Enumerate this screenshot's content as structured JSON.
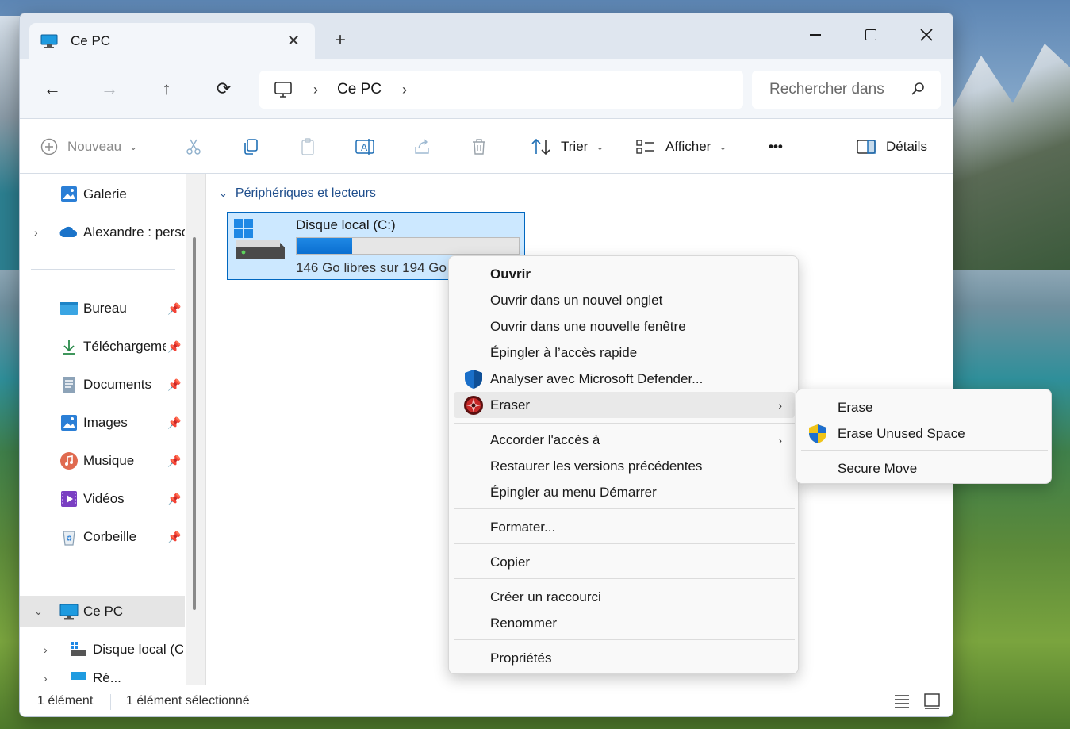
{
  "window": {
    "tab_title": "Ce PC",
    "tab_close": "✕",
    "new_tab": "+"
  },
  "nav": {
    "back": "←",
    "forward": "→",
    "up": "↑",
    "refresh": "⟳",
    "breadcrumb": [
      "Ce PC"
    ],
    "crumb_sep": "›",
    "search_placeholder": "Rechercher dans"
  },
  "toolbar": {
    "new_label": "Nouveau",
    "sort_label": "Trier",
    "view_label": "Afficher",
    "more_label": "•••",
    "details_label": "Détails"
  },
  "sidebar": {
    "items": [
      {
        "label": "Galerie",
        "icon": "gallery-icon"
      },
      {
        "label": "Alexandre : perso",
        "icon": "onedrive-cloud-icon"
      },
      {
        "label": "Bureau",
        "icon": "desktop-folder-icon"
      },
      {
        "label": "Téléchargements",
        "icon": "download-icon"
      },
      {
        "label": "Documents",
        "icon": "documents-icon"
      },
      {
        "label": "Images",
        "icon": "pictures-icon"
      },
      {
        "label": "Musique",
        "icon": "music-icon"
      },
      {
        "label": "Vidéos",
        "icon": "videos-icon"
      },
      {
        "label": "Corbeille",
        "icon": "recycle-bin-icon"
      },
      {
        "label": "Ce PC",
        "icon": "this-pc-icon"
      },
      {
        "label": "Disque local (C:)",
        "icon": "drive-icon"
      },
      {
        "label": "Ré...",
        "icon": "network-icon"
      }
    ],
    "pin": "📌"
  },
  "main": {
    "group_title": "Périphériques et lecteurs",
    "drive": {
      "name": "Disque local (C:)",
      "free_text": "146 Go libres sur 194 Go",
      "used_fraction": 0.25
    }
  },
  "context_menu": {
    "items": [
      "Ouvrir",
      "Ouvrir dans un nouvel onglet",
      "Ouvrir dans une nouvelle fenêtre",
      "Épingler à l’accès rapide",
      "Analyser avec Microsoft Defender...",
      "Eraser",
      "Accorder l'accès à",
      "Restaurer les versions précédentes",
      "Épingler au menu Démarrer",
      "Formater...",
      "Copier",
      "Créer un raccourci",
      "Renommer",
      "Propriétés"
    ],
    "arrow": "›"
  },
  "submenu": {
    "items": [
      "Erase",
      "Erase Unused Space",
      "Secure Move"
    ]
  },
  "status": {
    "count": "1 élément",
    "selected": "1 élément sélectionné"
  },
  "colors": {
    "accent": "#0067c0",
    "selection": "#cce8ff"
  }
}
